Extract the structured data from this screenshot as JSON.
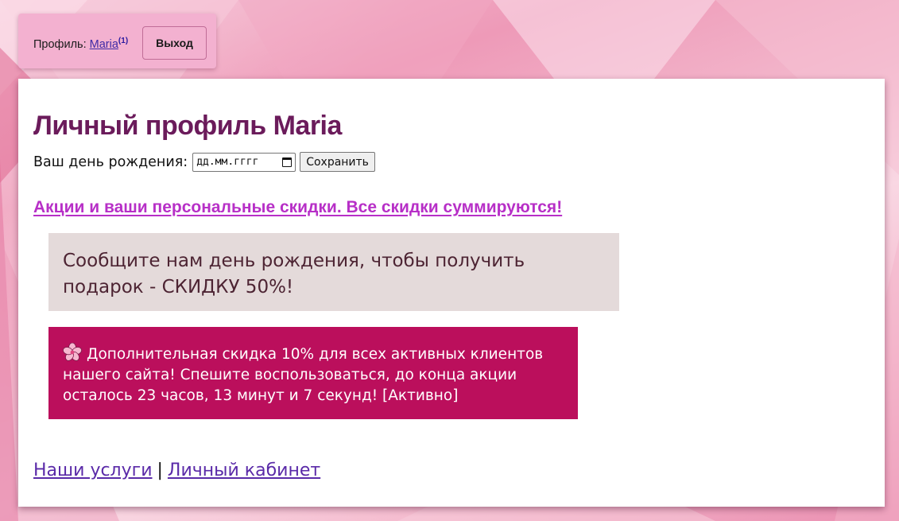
{
  "header": {
    "profile_label": "Профиль:",
    "username": "Maria",
    "notification_count": "(1)",
    "logout_label": "Выход"
  },
  "main": {
    "title": "Личный профиль Maria",
    "birthday": {
      "label": "Ваш день рождения:",
      "placeholder": "дд.мм.гггг",
      "save_label": "Сохранить"
    },
    "promo_link": "Акции и ваши персональные скидки. Все скидки суммируются!",
    "birthday_notice": "Сообщите нам день рождения, чтобы получить подарок - СКИДКУ 50%!",
    "discount_banner": "Дополнительная скидка 10% для всех активных клиентов нашего сайта! Спешите воспользоваться, до конца акции осталось 23 часов, 13 минут и 7 секунд! [Активно]"
  },
  "footer": {
    "services_link": "Наши услуги",
    "separator": "|",
    "cabinet_link": "Личный кабинет"
  },
  "colors": {
    "title": "#6b1b5b",
    "promo_link": "#b72fc7",
    "notice_bg": "#e4dada",
    "banner_bg": "#bb0f5c",
    "link": "#5a2aa8"
  }
}
